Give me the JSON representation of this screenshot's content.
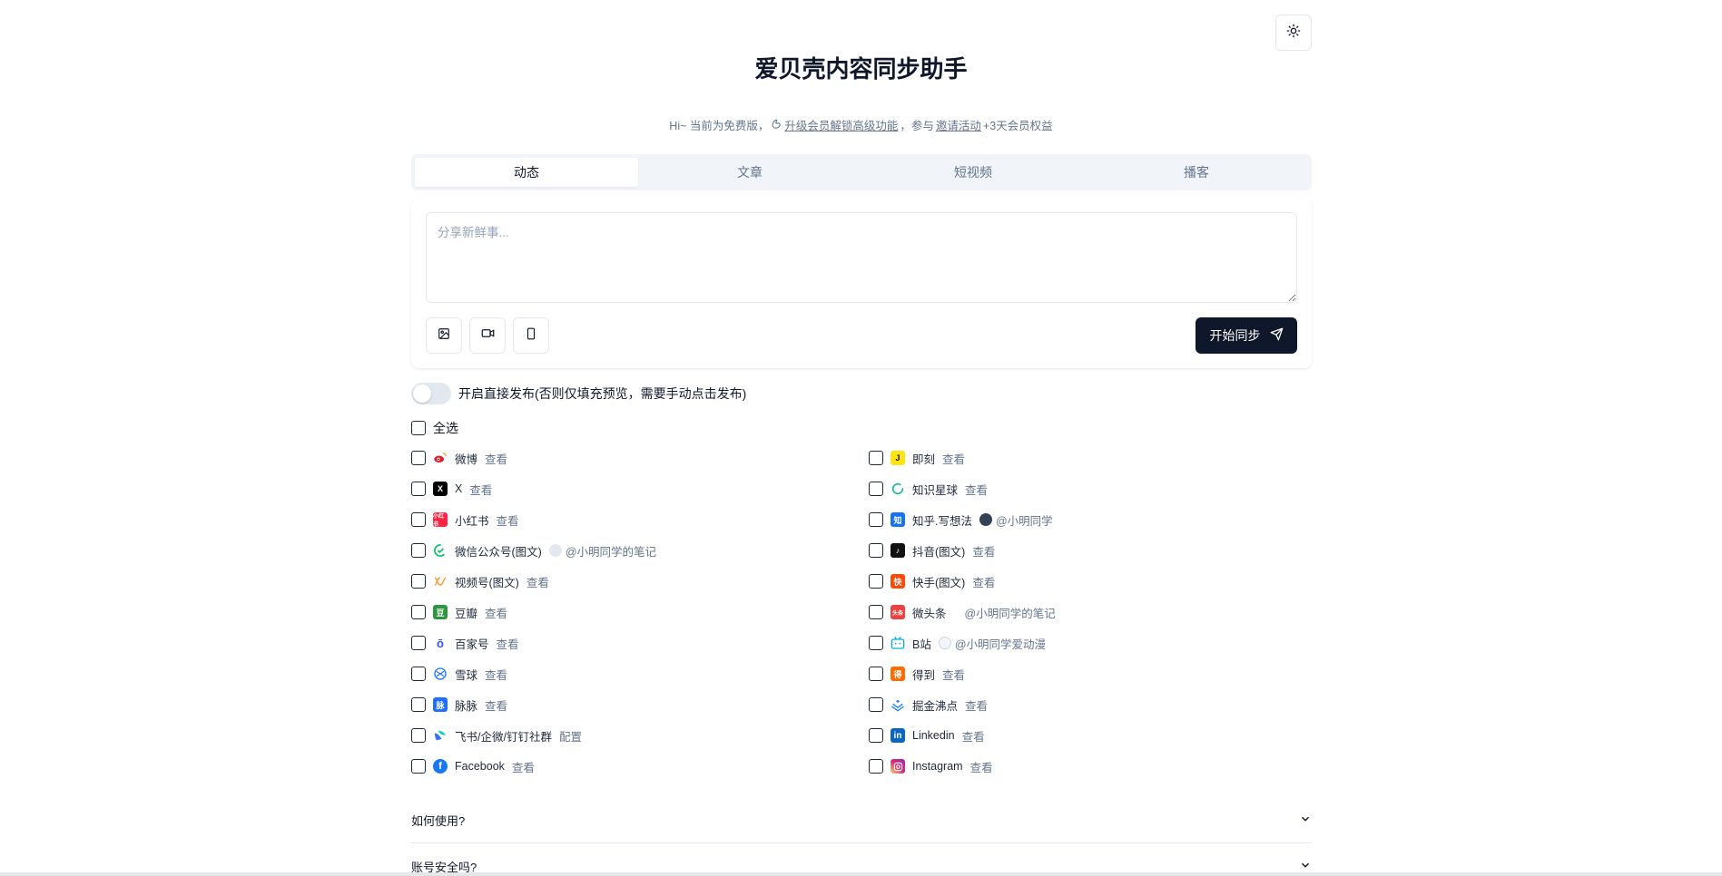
{
  "header": {
    "title": "爱贝壳内容同步助手",
    "subtitle_prefix": "Hi~ 当前为免费版，",
    "upgrade_link": "升级会员解锁高级功能",
    "subtitle_mid": "，参与",
    "invite_link": "邀请活动",
    "subtitle_suffix": "+3天会员权益",
    "theme_icon": "sun-icon"
  },
  "tabs": [
    {
      "label": "动态",
      "active": true
    },
    {
      "label": "文章",
      "active": false
    },
    {
      "label": "短视频",
      "active": false
    },
    {
      "label": "播客",
      "active": false
    }
  ],
  "composer": {
    "placeholder": "分享新鲜事...",
    "value": "",
    "sync_label": "开始同步"
  },
  "direct_publish": {
    "label": "开启直接发布(否则仅填充预览，需要手动点击发布)",
    "enabled": false
  },
  "select_all_label": "全选",
  "platforms_left": [
    {
      "name": "微博",
      "action": "查看",
      "icon": "weibo-icon",
      "color": "#e6162d"
    },
    {
      "name": "X",
      "action": "查看",
      "icon": "x-icon",
      "color": "#000000"
    },
    {
      "name": "小红书",
      "action": "查看",
      "icon": "xiaohongshu-icon",
      "color": "#ff2442"
    },
    {
      "name": "微信公众号(图文)",
      "account": "@小明同学的笔记",
      "icon": "wechat-icon",
      "color": "#07c160"
    },
    {
      "name": "视频号(图文)",
      "action": "查看",
      "icon": "channels-icon",
      "color": "#fa9d3b"
    },
    {
      "name": "豆瓣",
      "action": "查看",
      "icon": "douban-icon",
      "color": "#2e963d"
    },
    {
      "name": "百家号",
      "action": "查看",
      "icon": "baijiahao-icon",
      "color": "#2d55f5"
    },
    {
      "name": "雪球",
      "action": "查看",
      "icon": "xueqiu-icon",
      "color": "#1a74ff"
    },
    {
      "name": "脉脉",
      "action": "查看",
      "icon": "maimai-icon",
      "color": "#1e6eff"
    },
    {
      "name": "飞书/企微/钉钉社群",
      "action": "配置",
      "icon": "feishu-icon",
      "color": "#3370ff"
    },
    {
      "name": "Facebook",
      "action": "查看",
      "icon": "facebook-icon",
      "color": "#1877f2"
    }
  ],
  "platforms_right": [
    {
      "name": "即刻",
      "action": "查看",
      "icon": "jike-icon",
      "color": "#ffe411"
    },
    {
      "name": "知识星球",
      "action": "查看",
      "icon": "zsxq-icon",
      "color": "#16b998"
    },
    {
      "name": "知乎.写想法",
      "account": "@小明同学",
      "icon": "zhihu-icon",
      "color": "#1772f6"
    },
    {
      "name": "抖音(图文)",
      "action": "查看",
      "icon": "douyin-icon",
      "color": "#111111"
    },
    {
      "name": "快手(图文)",
      "action": "查看",
      "icon": "kuaishou-icon",
      "color": "#ff4906"
    },
    {
      "name": "微头条",
      "account": "@小明同学的笔记",
      "icon": "toutiao-icon",
      "color": "#f04142"
    },
    {
      "name": "B站",
      "account": "@小明同学爱动漫",
      "icon": "bilibili-icon",
      "color": "#00aeec"
    },
    {
      "name": "得到",
      "action": "查看",
      "icon": "dedao-icon",
      "color": "#ff6b00"
    },
    {
      "name": "掘金沸点",
      "action": "查看",
      "icon": "juejin-icon",
      "color": "#1e80ff"
    },
    {
      "name": "Linkedin",
      "action": "查看",
      "icon": "linkedin-icon",
      "color": "#0a66c2"
    },
    {
      "name": "Instagram",
      "action": "查看",
      "icon": "instagram-icon",
      "color": "#e1306c"
    }
  ],
  "faq": [
    {
      "question": "如何使用?"
    },
    {
      "question": "账号安全吗?"
    }
  ]
}
